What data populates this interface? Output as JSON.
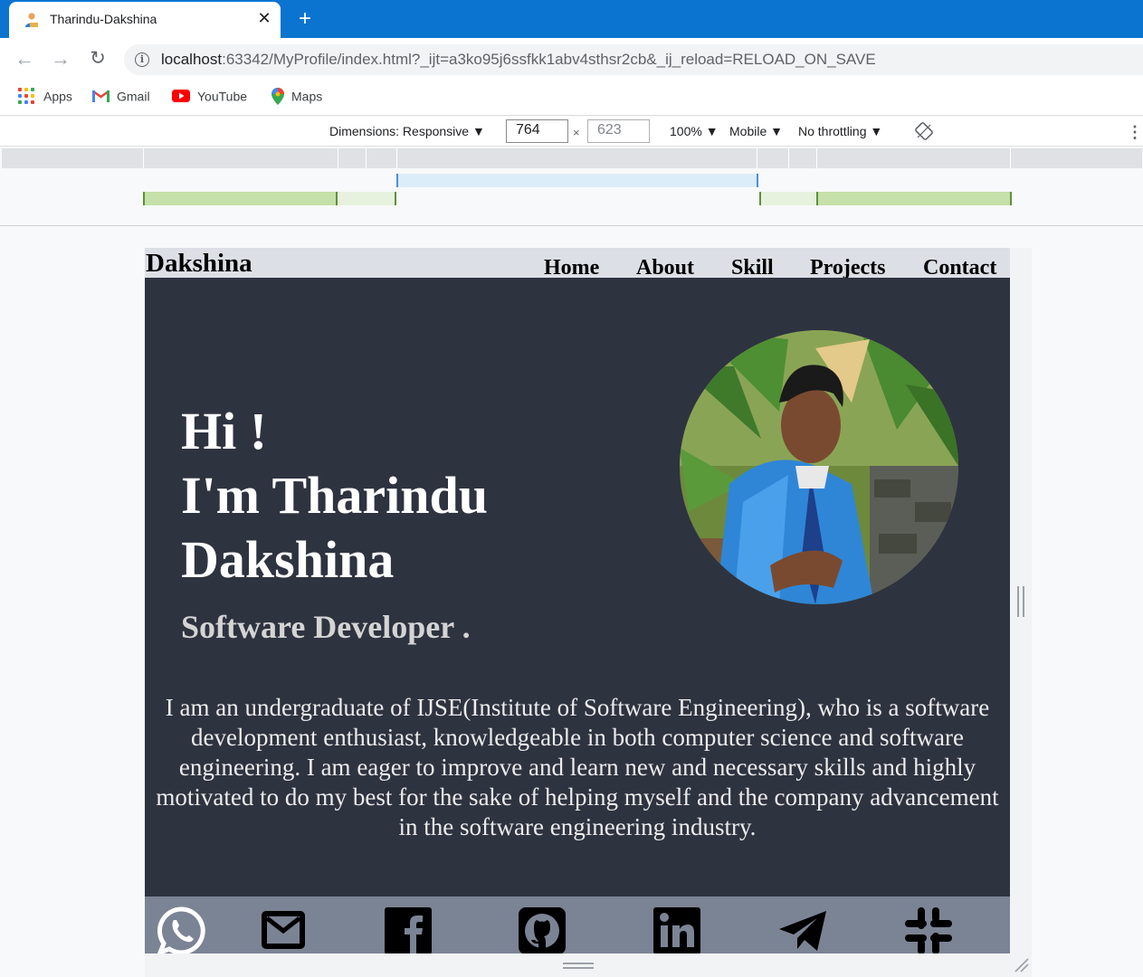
{
  "browser": {
    "tab_title": "Tharindu-Dakshina",
    "url_host": "localhost",
    "url_rest": ":63342/MyProfile/index.html?_ijt=a3ko95j6ssfkk1abv4sthsr2cb&_ij_reload=RELOAD_ON_SAVE",
    "bookmarks": [
      {
        "label": "Apps",
        "icon": "apps-grid-icon"
      },
      {
        "label": "Gmail",
        "icon": "gmail-icon"
      },
      {
        "label": "YouTube",
        "icon": "youtube-icon"
      },
      {
        "label": "Maps",
        "icon": "maps-icon"
      }
    ]
  },
  "devtools": {
    "dimensions_label": "Dimensions: Responsive ▼",
    "width": "764",
    "height": "623",
    "zoom": "100% ▼",
    "device": "Mobile ▼",
    "throttling": "No throttling ▼"
  },
  "site": {
    "brand": "Dakshina",
    "nav": [
      "Home",
      "About",
      "Skill",
      "Projects",
      "Contact"
    ],
    "greeting_line1": "Hi !",
    "greeting_line2": "I'm Tharindu",
    "greeting_line3": "Dakshina",
    "role": "Software Developer .",
    "bio": "I am an undergraduate of IJSE(Institute of Software Engineering), who is a software development enthusiast, knowledgeable in both computer science and software engineering. I am eager to improve and learn new and necessary skills and highly motivated to do my best for the sake of helping myself and the company advancement in the software engineering industry.",
    "social_icons": [
      "whatsapp-icon",
      "email-icon",
      "facebook-icon",
      "github-icon",
      "linkedin-icon",
      "telegram-icon",
      "slack-icon"
    ]
  },
  "colors": {
    "chrome_blue": "#0b74d1",
    "hero_bg": "#2e3340",
    "nav_bg": "#dcdfe5",
    "social_bg": "#7b8494"
  }
}
